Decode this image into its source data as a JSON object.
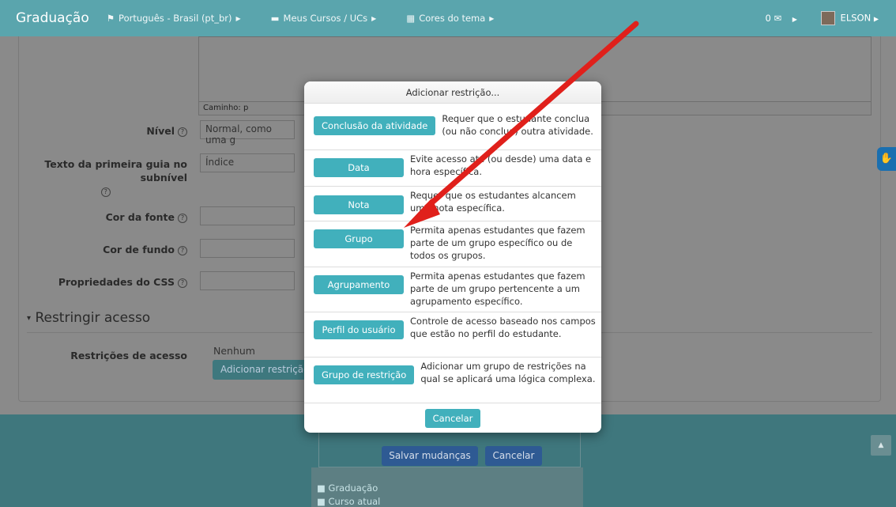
{
  "navbar": {
    "brand": "Graduação",
    "language": "Português - Brasil (pt_br)",
    "courses": "Meus Cursos / UCs",
    "theme": "Cores do tema",
    "messages": "0",
    "user": "ELSON"
  },
  "form": {
    "editor_path": "Caminho: p",
    "nivel_label": "Nível",
    "nivel_value": "Normal, como uma g",
    "texto_label_1": "Texto da primeira guia no",
    "texto_label_2": "subnível",
    "texto_value": "Índice",
    "cor_fonte_label": "Cor da fonte",
    "cor_fundo_label": "Cor de fundo",
    "css_label": "Propriedades do CSS",
    "section_title": "Restringir acesso",
    "restricoes_label": "Restrições de acesso",
    "restricoes_value": "Nenhum",
    "add_restriction_button": "Adicionar restrição..."
  },
  "dialog": {
    "title": "Adicionar restrição...",
    "options": [
      {
        "label": "Conclusão da atividade",
        "description": "Requer que o estudante conclua (ou não conclua) outra atividade."
      },
      {
        "label": "Data",
        "description": "Evite acesso até (ou desde) uma data e hora específica."
      },
      {
        "label": "Nota",
        "description": "Requer que os estudantes alcancem uma nota específica."
      },
      {
        "label": "Grupo",
        "description": "Permita apenas estudantes que fazem parte de um grupo específico ou de todos os grupos."
      },
      {
        "label": "Agrupamento",
        "description": "Permita apenas estudantes que fazem parte de um grupo pertencente a um agrupamento específico."
      },
      {
        "label": "Perfil do usuário",
        "description": "Controle de acesso baseado nos campos que estão no perfil do estudante."
      },
      {
        "label": "Grupo de restrição",
        "description": "Adicionar um grupo de restrições na qual se aplicará uma lógica complexa."
      }
    ],
    "cancel": "Cancelar"
  },
  "footer": {
    "save": "Salvar mudanças",
    "cancel": "Cancelar",
    "links": [
      "Graduação",
      "Curso atual"
    ]
  },
  "colors": {
    "navbar": "#5aa5ad",
    "button": "#41b0bc",
    "arrow": "#e0201b"
  },
  "icons": [
    "flag-icon",
    "briefcase-icon",
    "grid-icon",
    "envelope-icon",
    "help-icon",
    "folder-icon",
    "hand-icon",
    "arrow-up-icon"
  ]
}
